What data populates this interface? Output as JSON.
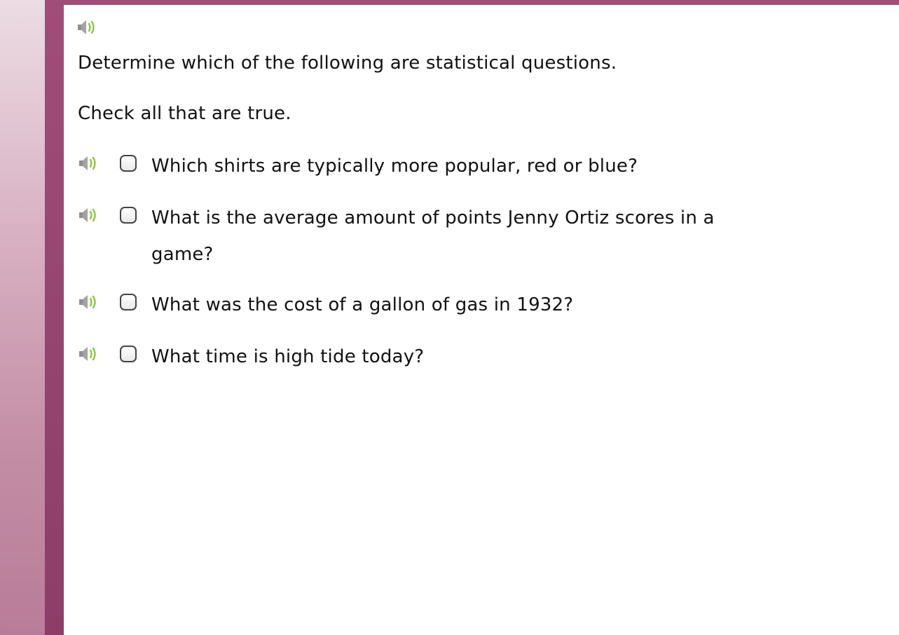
{
  "question": {
    "instruction": "Determine which of the following are statistical questions.",
    "sub_instruction": "Check all that are true.",
    "speaker_icon": "speaker-audio-icon"
  },
  "options": [
    {
      "label": "Which shirts are typically more popular, red or blue?",
      "checked": false
    },
    {
      "label": "What is the average amount of points Jenny Ortiz scores in a game?",
      "checked": false
    },
    {
      "label": "What was the cost of a gallon of gas in 1932?",
      "checked": false
    },
    {
      "label": "What time is high tide today?",
      "checked": false
    }
  ],
  "colors": {
    "frame": "#a24d79",
    "speaker_body": "#9a9a9a",
    "speaker_waves": "#8cc63f"
  }
}
